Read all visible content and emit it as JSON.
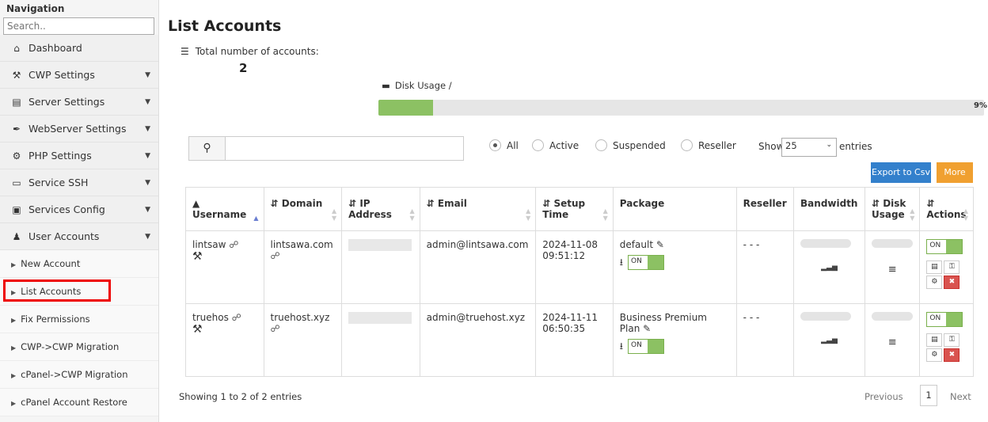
{
  "sidebar": {
    "title": "Navigation",
    "search_placeholder": "Search..",
    "items": [
      {
        "label": "Dashboard",
        "icon": "home-icon",
        "glyph": "⌂",
        "caret": false
      },
      {
        "label": "CWP Settings",
        "icon": "tools-icon",
        "glyph": "⚒",
        "caret": true
      },
      {
        "label": "Server Settings",
        "icon": "server-icon",
        "glyph": "▤",
        "caret": true
      },
      {
        "label": "WebServer Settings",
        "icon": "pen-icon",
        "glyph": "✒",
        "caret": true
      },
      {
        "label": "PHP Settings",
        "icon": "gear-icon",
        "glyph": "⚙",
        "caret": true
      },
      {
        "label": "Service SSH",
        "icon": "monitor-icon",
        "glyph": "▭",
        "caret": true
      },
      {
        "label": "Services Config",
        "icon": "config-icon",
        "glyph": "▣",
        "caret": true
      },
      {
        "label": "User Accounts",
        "icon": "user-icon",
        "glyph": "♟",
        "caret": true
      }
    ],
    "subitems": [
      {
        "label": "New Account",
        "active": false
      },
      {
        "label": "List Accounts",
        "active": true
      },
      {
        "label": "Fix Permissions",
        "active": false
      },
      {
        "label": "CWP->CWP Migration",
        "active": false
      },
      {
        "label": "cPanel->CWP Migration",
        "active": false
      },
      {
        "label": "cPanel Account Restore",
        "active": false
      }
    ]
  },
  "main": {
    "title": "List Accounts",
    "total_label": "Total number of accounts:",
    "total_value": "2",
    "disk_label": "Disk Usage /",
    "disk_percent": 9,
    "disk_percent_text": "9%",
    "filters": [
      "All",
      "Active",
      "Suspended",
      "Reseller"
    ],
    "filter_selected": "All",
    "show_label": "Show",
    "show_value": "25",
    "entries_label": "entries",
    "export_label": "Export to Csv",
    "more_label": "More",
    "columns": [
      "Username",
      "Domain",
      "IP Address",
      "Email",
      "Setup Time",
      "Package",
      "Reseller",
      "Bandwidth",
      "Disk Usage",
      "Actions"
    ],
    "rows": [
      {
        "username": "lintsaw",
        "domain": "lintsawa.com",
        "email": "admin@lintsawa.com",
        "setup_time": "2024-11-08 09:51:12",
        "package": "default",
        "reseller": "- - -",
        "toggle_pkg": "ON",
        "toggle_action": "ON"
      },
      {
        "username": "truehos",
        "domain": "truehost.xyz",
        "email": "admin@truehost.xyz",
        "setup_time": "2024-11-11 06:50:35",
        "package": "Business Premium Plan",
        "reseller": "- - -",
        "toggle_pkg": "ON",
        "toggle_action": "ON"
      }
    ],
    "showing_text": "Showing 1 to 2 of 2 entries",
    "pagination": {
      "prev": "Previous",
      "current": "1",
      "next": "Next"
    }
  },
  "colors": {
    "accent_green": "#8cc163",
    "export_blue": "#3380cc",
    "more_orange": "#f0a030",
    "delete_red": "#d9534f",
    "highlight_red": "#e00000"
  }
}
